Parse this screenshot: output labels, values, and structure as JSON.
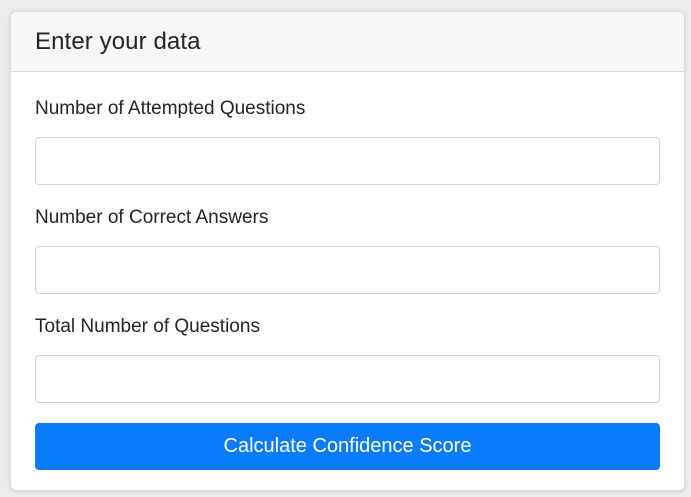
{
  "card": {
    "title": "Enter your data"
  },
  "form": {
    "fields": [
      {
        "label": "Number of Attempted Questions",
        "value": "",
        "placeholder": ""
      },
      {
        "label": "Number of Correct Answers",
        "value": "",
        "placeholder": ""
      },
      {
        "label": "Total Number of Questions",
        "value": "",
        "placeholder": ""
      }
    ],
    "submit_label": "Calculate Confidence Score"
  },
  "colors": {
    "accent": "#0a7cfb",
    "header_bg": "#f7f7f7",
    "page_bg": "#ececec"
  }
}
